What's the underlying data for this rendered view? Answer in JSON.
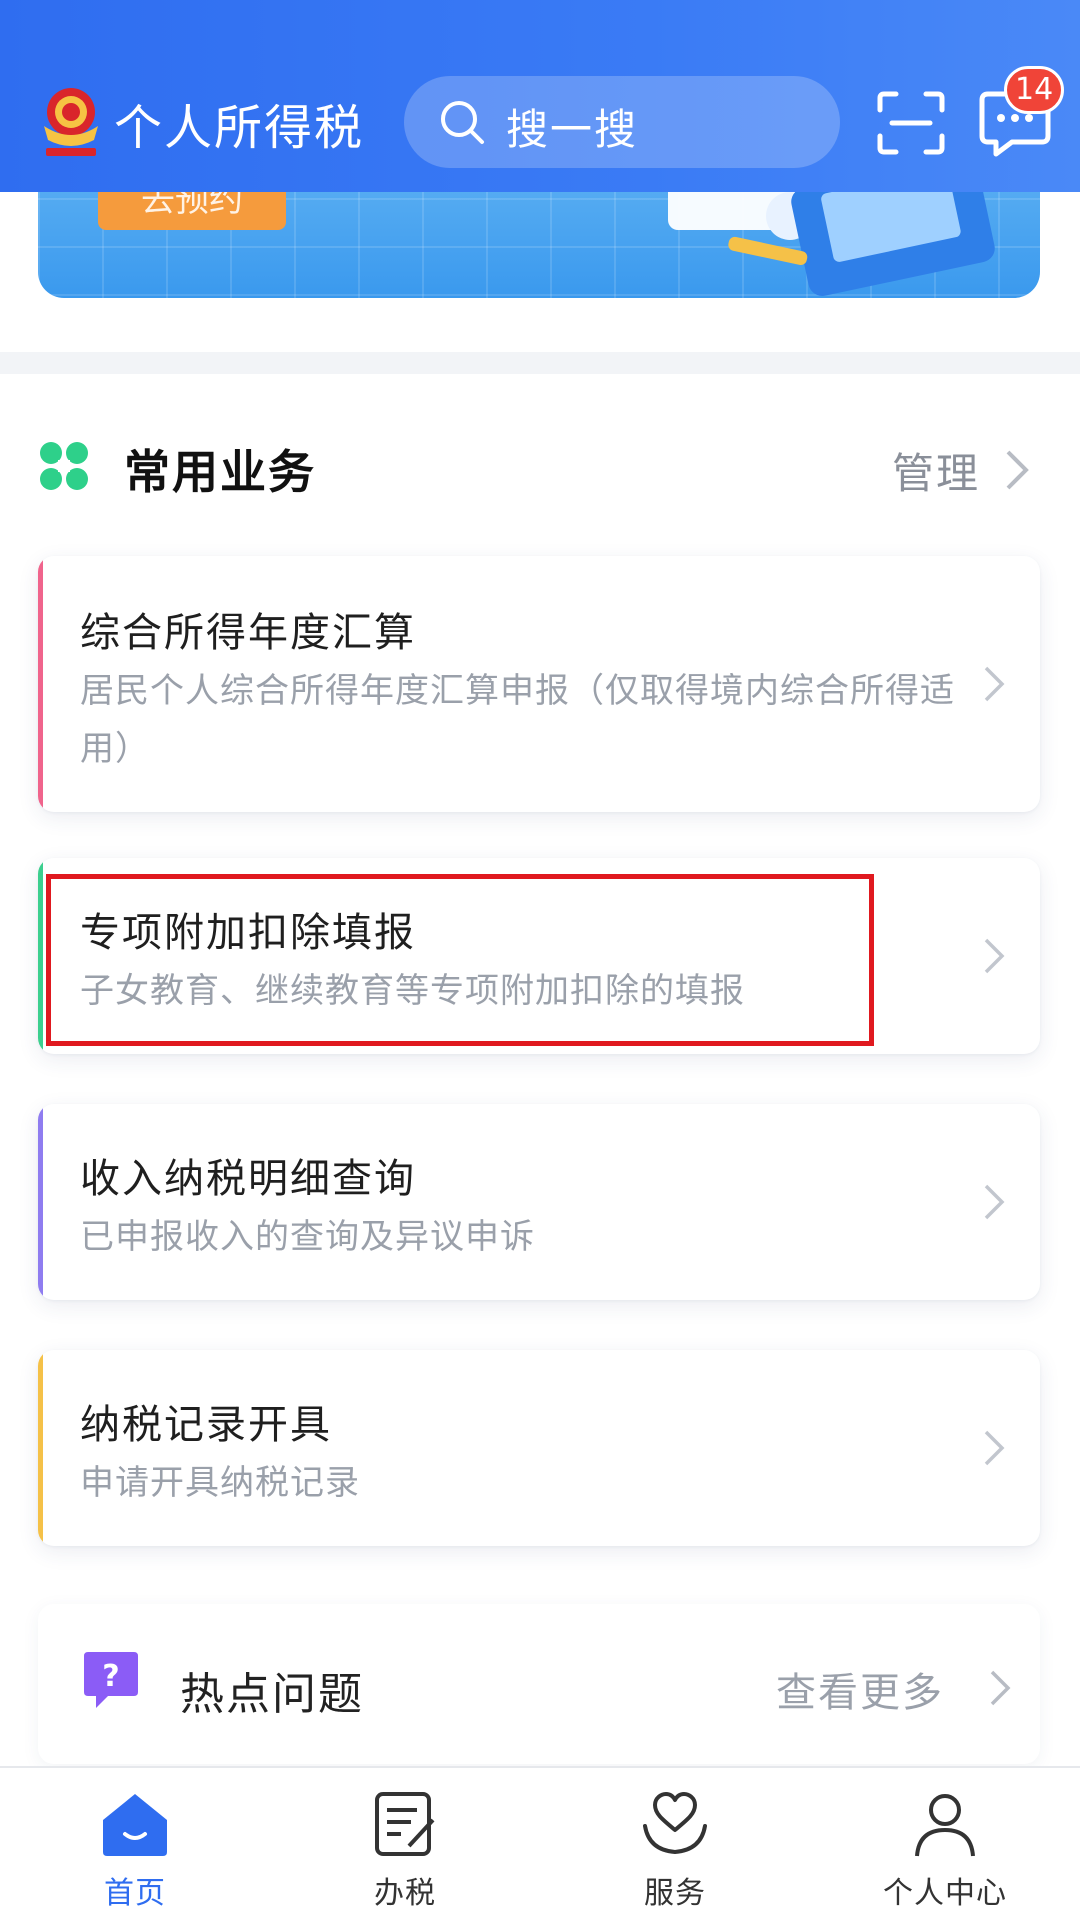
{
  "header": {
    "app_title": "个人所得税",
    "search_placeholder": "搜一搜",
    "message_badge": "14"
  },
  "banner": {
    "button_label": "去预约"
  },
  "section": {
    "title": "常用业务",
    "manage_label": "管理"
  },
  "cards": [
    {
      "title": "综合所得年度汇算",
      "desc": "居民个人综合所得年度汇算申报（仅取得境内综合所得适用）",
      "accent": "#f0648c"
    },
    {
      "title": "专项附加扣除填报",
      "desc": "子女教育、继续教育等专项附加扣除的填报",
      "accent": "#3ccf8e"
    },
    {
      "title": "收入纳税明细查询",
      "desc": "已申报收入的查询及异议申诉",
      "accent": "#8f7cf0"
    },
    {
      "title": "纳税记录开具",
      "desc": "申请开具纳税记录",
      "accent": "#f5c148"
    }
  ],
  "hot_issues": {
    "title": "热点问题",
    "more_label": "查看更多"
  },
  "tabbar": {
    "items": [
      {
        "label": "首页",
        "icon": "home-icon",
        "active": true
      },
      {
        "label": "办税",
        "icon": "tax-form-icon",
        "active": false
      },
      {
        "label": "服务",
        "icon": "service-heart-icon",
        "active": false
      },
      {
        "label": "个人中心",
        "icon": "user-icon",
        "active": false
      }
    ]
  },
  "colors": {
    "primary": "#2f6df0",
    "badge": "#f04438",
    "highlight_border": "#e0191f"
  }
}
